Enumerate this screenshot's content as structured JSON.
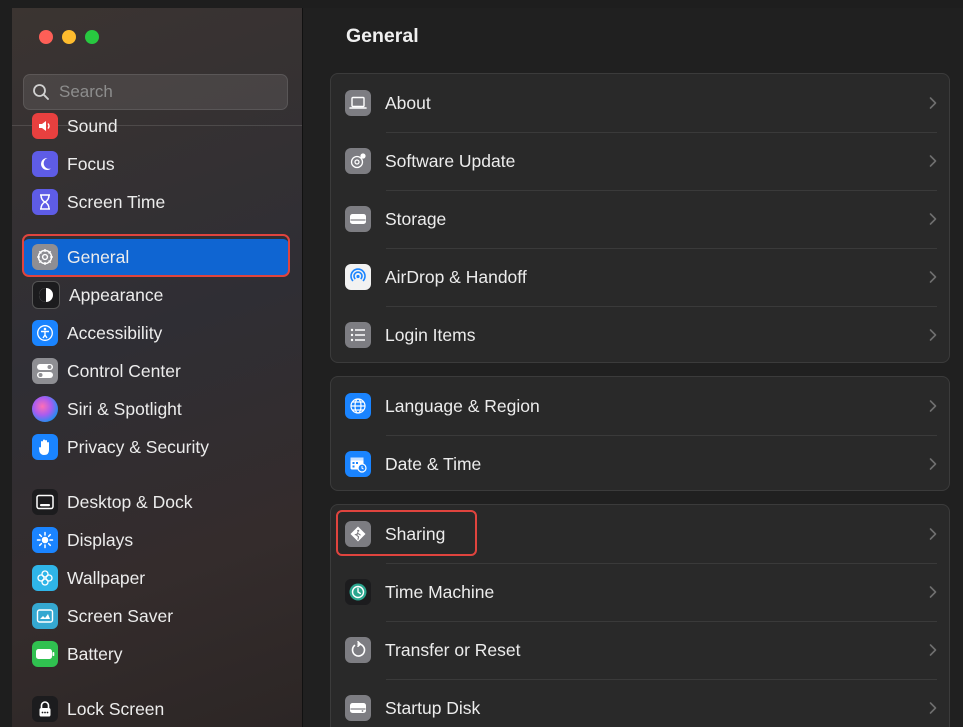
{
  "window": {
    "traffic_lights": [
      {
        "name": "close",
        "color": "#fe5f57"
      },
      {
        "name": "minimize",
        "color": "#febc2e"
      },
      {
        "name": "zoom",
        "color": "#28c840"
      }
    ]
  },
  "search": {
    "placeholder": "Search",
    "value": ""
  },
  "sidebar": {
    "items": [
      {
        "label": "Sound",
        "icon": "speaker-icon",
        "color": "#e8403f"
      },
      {
        "label": "Focus",
        "icon": "moon-icon",
        "color": "#5e5ce6"
      },
      {
        "label": "Screen Time",
        "icon": "hourglass-icon",
        "color": "#5e5ce6"
      },
      {
        "label": "General",
        "icon": "gear-icon",
        "color": "#8e8e93",
        "selected": true
      },
      {
        "label": "Appearance",
        "icon": "appearance-icon",
        "color": "#1c1c1e"
      },
      {
        "label": "Accessibility",
        "icon": "accessibility-icon",
        "color": "#1a84ff"
      },
      {
        "label": "Control Center",
        "icon": "toggles-icon",
        "color": "#8e8e93"
      },
      {
        "label": "Siri & Spotlight",
        "icon": "siri-icon",
        "color": "#c04bd8"
      },
      {
        "label": "Privacy & Security",
        "icon": "hand-icon",
        "color": "#1a84ff"
      },
      {
        "label": "Desktop & Dock",
        "icon": "dock-icon",
        "color": "#1c1c1e"
      },
      {
        "label": "Displays",
        "icon": "sun-icon",
        "color": "#1a84ff"
      },
      {
        "label": "Wallpaper",
        "icon": "flower-icon",
        "color": "#2fb5e8"
      },
      {
        "label": "Screen Saver",
        "icon": "screensaver-icon",
        "color": "#35a8d0"
      },
      {
        "label": "Battery",
        "icon": "battery-icon",
        "color": "#30c150"
      },
      {
        "label": "Lock Screen",
        "icon": "lock-icon",
        "color": "#1c1c1e"
      }
    ]
  },
  "main": {
    "title": "General",
    "groups": [
      {
        "rows": [
          {
            "label": "About",
            "icon": "laptop-icon"
          },
          {
            "label": "Software Update",
            "icon": "gear-badge-icon"
          },
          {
            "label": "Storage",
            "icon": "drive-icon"
          },
          {
            "label": "AirDrop & Handoff",
            "icon": "airdrop-icon"
          },
          {
            "label": "Login Items",
            "icon": "list-icon"
          }
        ]
      },
      {
        "rows": [
          {
            "label": "Language & Region",
            "icon": "globe-icon"
          },
          {
            "label": "Date & Time",
            "icon": "calendar-clock-icon"
          }
        ]
      },
      {
        "rows": [
          {
            "label": "Sharing",
            "icon": "sharing-icon",
            "highlighted": true
          },
          {
            "label": "Time Machine",
            "icon": "time-machine-icon"
          },
          {
            "label": "Transfer or Reset",
            "icon": "reset-icon"
          },
          {
            "label": "Startup Disk",
            "icon": "disk-icon"
          }
        ]
      }
    ]
  },
  "colors": {
    "selection": "#0f65d2",
    "highlight_outline": "#e0443e"
  }
}
